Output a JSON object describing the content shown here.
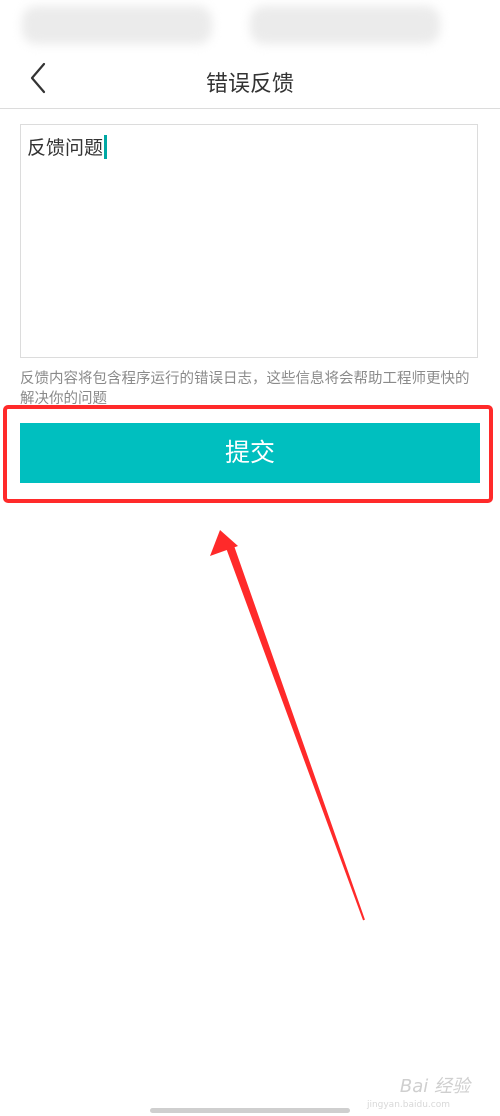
{
  "header": {
    "title": "错误反馈",
    "back_icon": "chevron-left-icon"
  },
  "feedback": {
    "value": "反馈问题",
    "hint": "反馈内容将包含程序运行的错误日志，这些信息将会帮助工程师更快的解决你的问题"
  },
  "actions": {
    "submit_label": "提交"
  },
  "annotation": {
    "highlight_color": "#ff2a2a",
    "arrow_color": "#ff2a2a"
  },
  "watermark": {
    "text": "Bai 经验",
    "sub": "jingyan.baidu.com"
  },
  "colors": {
    "accent": "#00bfbf",
    "caret": "#00a8a4",
    "text": "#333333",
    "hint": "#8a8a8a"
  }
}
